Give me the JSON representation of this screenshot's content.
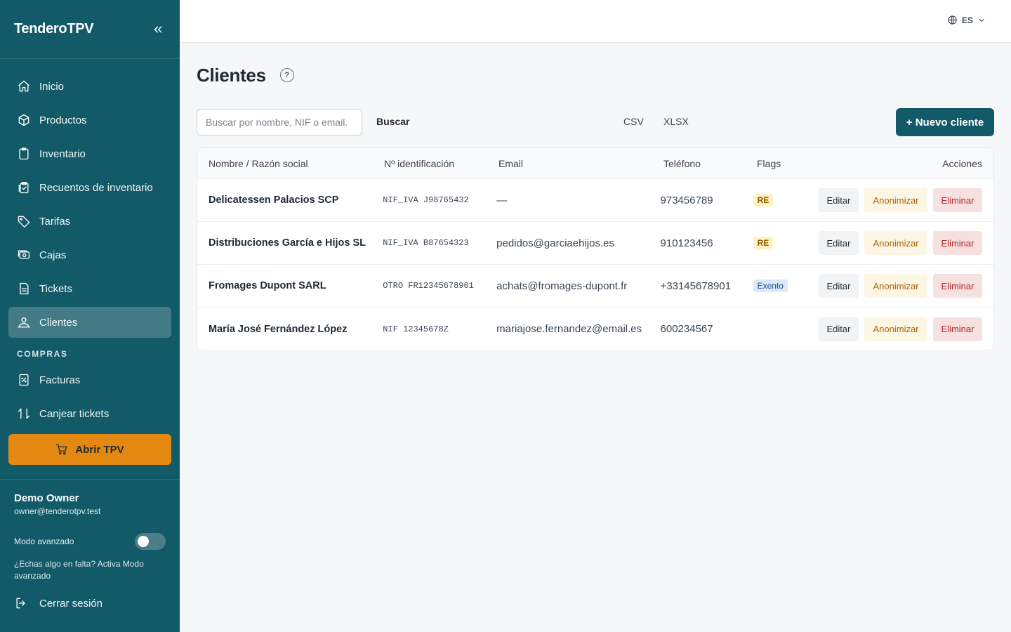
{
  "app": {
    "brand": "TenderoTPV"
  },
  "sidebar": {
    "items": [
      {
        "label": "Inicio",
        "icon": "home-icon"
      },
      {
        "label": "Productos",
        "icon": "box-icon"
      },
      {
        "label": "Inventario",
        "icon": "clipboard-icon"
      },
      {
        "label": "Recuentos de inventario",
        "icon": "clipboard-check-icon"
      },
      {
        "label": "Tarifas",
        "icon": "tag-icon"
      },
      {
        "label": "Cajas",
        "icon": "cash-register-icon"
      },
      {
        "label": "Tickets",
        "icon": "receipt-icon"
      },
      {
        "label": "Clientes",
        "icon": "users-icon",
        "active": true
      }
    ],
    "section_compras": "COMPRAS",
    "compras_items": [
      {
        "label": "Facturas",
        "icon": "invoice-icon"
      },
      {
        "label": "Canjear tickets",
        "icon": "swap-icon"
      }
    ],
    "open_tpv": "Abrir TPV",
    "user": {
      "name": "Demo Owner",
      "email": "owner@tenderotpv.test"
    },
    "advanced_mode_label": "Modo avanzado",
    "advanced_mode_on": false,
    "hint": "¿Echas algo en falta? Activa Modo avanzado",
    "logout": "Cerrar sesión"
  },
  "topbar": {
    "language": "ES"
  },
  "page": {
    "title": "Clientes",
    "help": "?",
    "search_placeholder": "Buscar por nombre, NIF o email.",
    "search_button": "Buscar",
    "export_csv": "CSV",
    "export_xlsx": "XLSX",
    "new_button": "+ Nuevo cliente"
  },
  "table": {
    "headers": {
      "name": "Nombre / Razón social",
      "id": "Nº identificación",
      "email": "Email",
      "phone": "Teléfono",
      "flags": "Flags",
      "actions": "Acciones"
    },
    "actions": {
      "edit": "Editar",
      "anonymize": "Anonimizar",
      "delete": "Eliminar"
    },
    "rows": [
      {
        "name": "Delicatessen Palacios SCP",
        "id": "NIF_IVA J98765432",
        "email": "—",
        "phone": "973456789",
        "flag": "RE",
        "flag_type": "re"
      },
      {
        "name": "Distribuciones García e Hijos SL",
        "id": "NIF_IVA B87654323",
        "email": "pedidos@garciaehijos.es",
        "phone": "910123456",
        "flag": "RE",
        "flag_type": "re"
      },
      {
        "name": "Fromages Dupont SARL",
        "id": "OTRO FR12345678901",
        "email": "achats@fromages-dupont.fr",
        "phone": "+33145678901",
        "flag": "Exento",
        "flag_type": "ex"
      },
      {
        "name": "María José Fernández López",
        "id": "NIF 12345678Z",
        "email": "mariajose.fernandez@email.es",
        "phone": "600234567",
        "flag": "",
        "flag_type": ""
      }
    ]
  },
  "colors": {
    "sidebar_bg": "#135a68",
    "accent_orange": "#e38912",
    "primary_button": "#135a68",
    "badge_re": "#fdf2c4",
    "badge_exento": "#dde8f7",
    "delete_bg": "#f6e0e0"
  }
}
